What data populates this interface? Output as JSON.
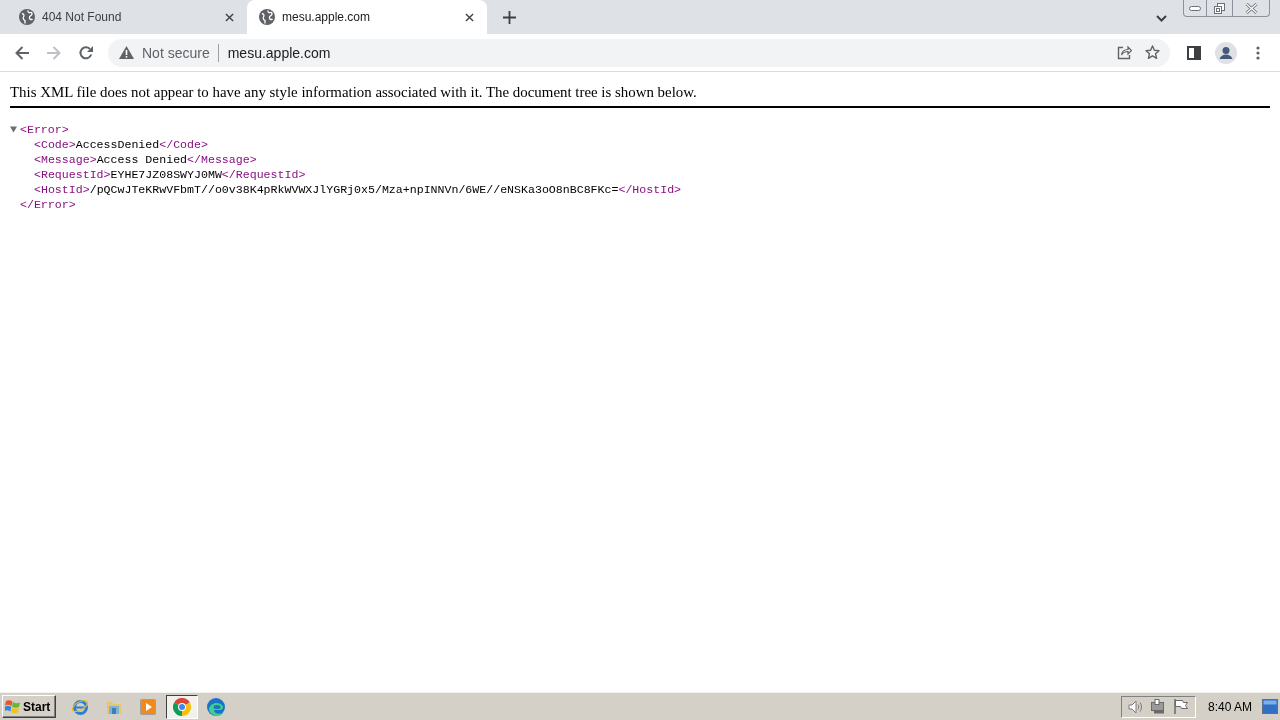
{
  "browser": {
    "tabs": [
      {
        "title": "404 Not Found",
        "selected": false
      },
      {
        "title": "mesu.apple.com",
        "selected": true
      }
    ],
    "navigation": {
      "back_disabled": false,
      "forward_disabled": true
    },
    "address_bar": {
      "security_label": "Not secure",
      "url": "mesu.apple.com"
    }
  },
  "page": {
    "notice": "This XML file does not appear to have any style information associated with it. The document tree is shown below.",
    "xml_tree": {
      "open_tag": "<Error>",
      "expanded": true,
      "children": [
        {
          "open_tag": "<Code>",
          "text": "AccessDenied",
          "close_tag": "</Code>"
        },
        {
          "open_tag": "<Message>",
          "text": "Access Denied",
          "close_tag": "</Message>"
        },
        {
          "open_tag": "<RequestId>",
          "text": "EYHE7JZ08SWYJ0MW",
          "close_tag": "</RequestId>"
        },
        {
          "open_tag": "<HostId>",
          "text": "/pQCwJTeKRwVFbmT//o0v38K4pRkWVWXJlYGRj0x5/Mza+npINNVn/6WE//eNSKa3oO8nBC8FKc=",
          "close_tag": "</HostId>"
        }
      ],
      "close_tag": "</Error>"
    }
  },
  "taskbar": {
    "start_label": "Start",
    "apps": [
      {
        "kind": "ie",
        "selected": false
      },
      {
        "kind": "folder",
        "selected": false
      },
      {
        "kind": "media",
        "selected": false
      },
      {
        "kind": "chrome",
        "selected": true
      },
      {
        "kind": "edge",
        "selected": false
      }
    ],
    "clock": "8:40 AM"
  }
}
